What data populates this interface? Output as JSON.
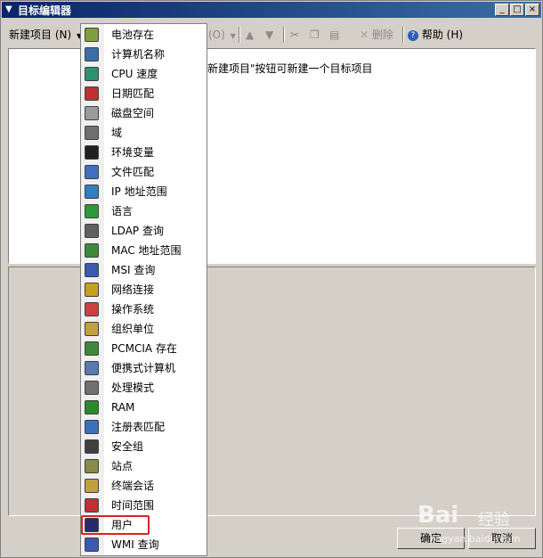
{
  "window": {
    "title": "目标编辑器",
    "min_glyph": "_",
    "max_glyph": "□",
    "close_glyph": "×"
  },
  "toolbar": {
    "new_item": "新建项目 (N)",
    "hidden_item_suffix": "(O)",
    "delete": "删除",
    "help": "帮助 (H)"
  },
  "pane": {
    "hint_fragment": "新建项目\"按钮可新建一个目标项目"
  },
  "menu": {
    "items": [
      {
        "label": "电池存在",
        "icon": "battery-icon",
        "color": "#7f9f3f"
      },
      {
        "label": "计算机名称",
        "icon": "computer-icon",
        "color": "#3a6ea5"
      },
      {
        "label": "CPU 速度",
        "icon": "cpu-icon",
        "color": "#2f8f6f"
      },
      {
        "label": "日期匹配",
        "icon": "calendar-icon",
        "color": "#c03030"
      },
      {
        "label": "磁盘空间",
        "icon": "disk-icon",
        "color": "#9a9a9a"
      },
      {
        "label": "域",
        "icon": "domain-icon",
        "color": "#707070"
      },
      {
        "label": "环境变量",
        "icon": "env-var-icon",
        "color": "#202020"
      },
      {
        "label": "文件匹配",
        "icon": "file-match-icon",
        "color": "#4070c0"
      },
      {
        "label": "IP 地址范围",
        "icon": "ip-range-icon",
        "color": "#3080c0"
      },
      {
        "label": "语言",
        "icon": "globe-icon",
        "color": "#2a9a3a"
      },
      {
        "label": "LDAP 查询",
        "icon": "ldap-icon",
        "color": "#606060"
      },
      {
        "label": "MAC 地址范围",
        "icon": "network-card-icon",
        "color": "#3a8a3a"
      },
      {
        "label": "MSI 查询",
        "icon": "msi-icon",
        "color": "#3a5ab0"
      },
      {
        "label": "网络连接",
        "icon": "network-connection-icon",
        "color": "#c8a020"
      },
      {
        "label": "操作系统",
        "icon": "os-icon",
        "color": "#d04040"
      },
      {
        "label": "组织单位",
        "icon": "ou-icon",
        "color": "#c0a040"
      },
      {
        "label": "PCMCIA 存在",
        "icon": "pcmcia-icon",
        "color": "#3a8a3a"
      },
      {
        "label": "便携式计算机",
        "icon": "laptop-icon",
        "color": "#5a7ab0"
      },
      {
        "label": "处理模式",
        "icon": "processing-mode-icon",
        "color": "#707070"
      },
      {
        "label": "RAM",
        "icon": "ram-icon",
        "color": "#2a8a2a"
      },
      {
        "label": "注册表匹配",
        "icon": "registry-icon",
        "color": "#3a70c0"
      },
      {
        "label": "安全组",
        "icon": "security-group-icon",
        "color": "#404040"
      },
      {
        "label": "站点",
        "icon": "site-icon",
        "color": "#8a8a4a"
      },
      {
        "label": "终端会话",
        "icon": "terminal-session-icon",
        "color": "#c0a040"
      },
      {
        "label": "时间范围",
        "icon": "clock-icon",
        "color": "#c03030"
      },
      {
        "label": "用户",
        "icon": "user-icon",
        "color": "#2a2a6a"
      },
      {
        "label": "WMI 查询",
        "icon": "wmi-icon",
        "color": "#3a5ab0"
      }
    ]
  },
  "buttons": {
    "ok": "确定",
    "cancel": "取消"
  },
  "watermark": {
    "brand": "Bai",
    "brand_cn": "经验",
    "url": "jingyan.baidu.com"
  }
}
